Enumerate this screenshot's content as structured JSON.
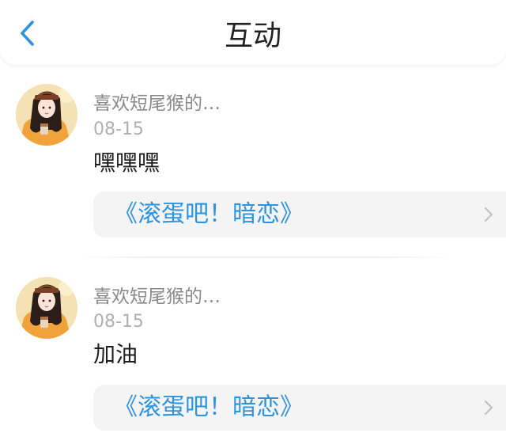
{
  "header": {
    "title": "互动",
    "back_icon": "chevron-left-icon",
    "accent_color": "#2c93e0"
  },
  "comments": [
    {
      "username": "喜欢短尾猴的…",
      "date": "08-15",
      "text": "嘿嘿嘿",
      "link_title": "《滚蛋吧！暗恋》",
      "link_icon": "chevron-right-icon"
    },
    {
      "username": "喜欢短尾猴的…",
      "date": "08-15",
      "text": "加油",
      "link_title": "《滚蛋吧！暗恋》",
      "link_icon": "chevron-right-icon"
    }
  ]
}
